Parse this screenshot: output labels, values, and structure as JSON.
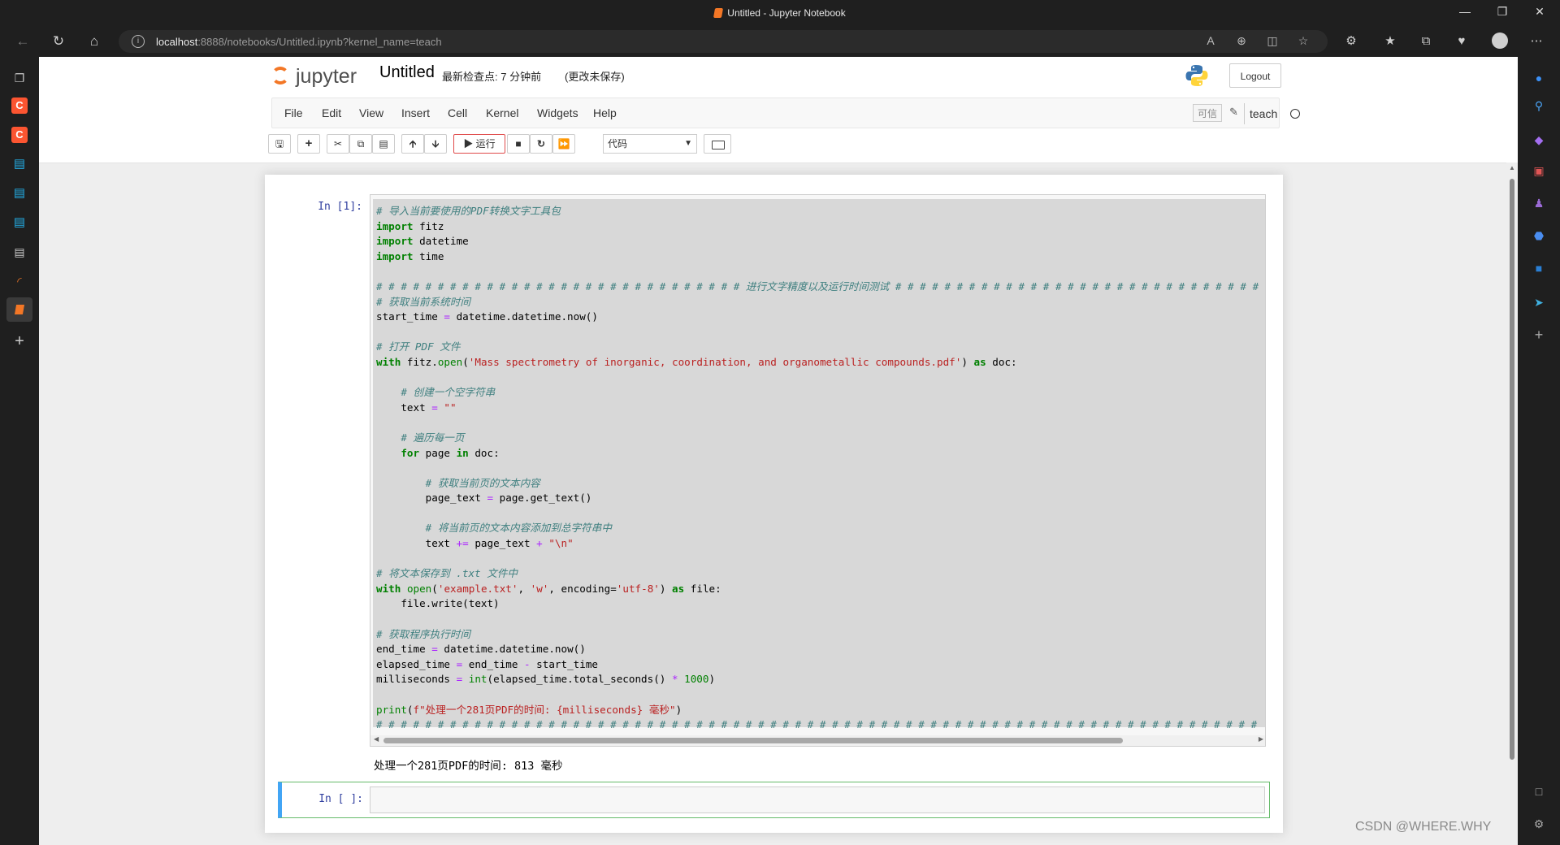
{
  "window": {
    "title": "Untitled - Jupyter Notebook"
  },
  "browser": {
    "url_host": "localhost",
    "url_rest": ":8888/notebooks/Untitled.ipynb?kernel_name=teach"
  },
  "header": {
    "logo_text": "jupyter",
    "notebook_name": "Untitled",
    "checkpoint": "最新检查点: 7 分钟前",
    "unsaved": "(更改未保存)",
    "logout_label": "Logout"
  },
  "menu": {
    "items": [
      "File",
      "Edit",
      "View",
      "Insert",
      "Cell",
      "Kernel",
      "Widgets",
      "Help"
    ],
    "trusted": "可信",
    "kernel_name": "teach"
  },
  "toolbar": {
    "run_label": "运行",
    "cell_type": "代码"
  },
  "cells": [
    {
      "prompt": "In  [1]:",
      "output": "处理一个281页PDF的时间: 813 毫秒"
    },
    {
      "prompt": "In  [ ]:"
    }
  ],
  "code_lines": [
    "# 导入当前要使用的PDF转换文字工具包",
    "import fitz",
    "import datetime",
    "import time",
    "",
    "# # # # # # # # # # # # # # # # # # # # # # # # # # # # # # 进行文字精度以及运行时间测试 # # # # # # # # # # # # # # # # # # # # # # # # # # # # # #",
    "# 获取当前系统时间",
    "start_time = datetime.datetime.now()",
    "",
    "# 打开 PDF 文件",
    "with fitz.open('Mass spectrometry of inorganic, coordination, and organometallic compounds.pdf') as doc:",
    "",
    "    # 创建一个空字符串",
    "    text = \"\"",
    "",
    "    # 遍历每一页",
    "    for page in doc:",
    "",
    "        # 获取当前页的文本内容",
    "        page_text = page.get_text()",
    "",
    "        # 将当前页的文本内容添加到总字符串中",
    "        text += page_text + \"\\n\"",
    "",
    "# 将文本保存到 .txt 文件中",
    "with open('example.txt', 'w', encoding='utf-8') as file:",
    "    file.write(text)",
    "",
    "# 获取程序执行时间",
    "end_time = datetime.datetime.now()",
    "elapsed_time = end_time - start_time",
    "milliseconds = int(elapsed_time.total_seconds() * 1000)",
    "",
    "print(f\"处理一个281页PDF的时间: {milliseconds} 毫秒\")",
    "# # # # # # # # # # # # # # # # # # # # # # # # # # # # # # # # # # # # # # # # # # # # # # # # # # # # # # # # # # # # # # # # # # # # # # # #"
  ],
  "watermark": "CSDN @WHERE.WHY",
  "icons": {
    "back": "arrow-left-icon",
    "refresh": "refresh-icon",
    "home": "home-icon",
    "save": "save-icon",
    "add": "plus-icon",
    "cut": "scissors-icon",
    "copy": "copy-icon",
    "paste": "paste-icon",
    "up": "arrow-up-icon",
    "down": "arrow-down-icon",
    "stop": "stop-icon",
    "restart": "restart-icon",
    "fastforward": "fast-forward-icon",
    "keyboard": "keyboard-icon"
  },
  "colors": {
    "jupyter_orange": "#f37726",
    "prompt_blue": "#303f9f",
    "edit_green": "#66bb6a",
    "browser_dark": "#1f1f1f"
  }
}
